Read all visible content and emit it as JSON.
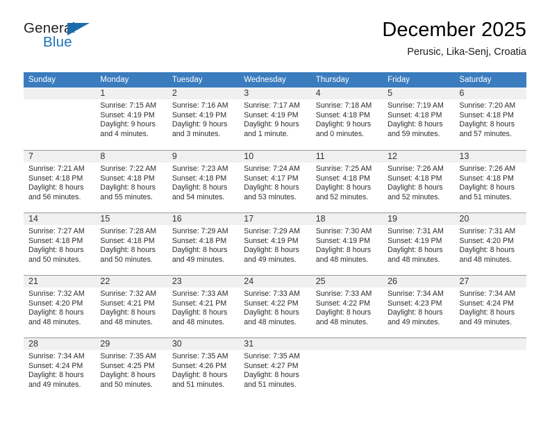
{
  "brand": {
    "name_part1": "General",
    "name_part2": "Blue",
    "accent_color": "#1b72b8",
    "triangle_icon": "triangle-icon"
  },
  "header": {
    "title": "December 2025",
    "location": "Perusic, Lika-Senj, Croatia"
  },
  "calendar": {
    "header_bg": "#3a7cbe",
    "weekday_headers": [
      "Sunday",
      "Monday",
      "Tuesday",
      "Wednesday",
      "Thursday",
      "Friday",
      "Saturday"
    ],
    "weeks": [
      [
        {
          "day": "",
          "sunrise": "",
          "sunset": "",
          "daylight_line1": "",
          "daylight_line2": ""
        },
        {
          "day": "1",
          "sunrise": "Sunrise: 7:15 AM",
          "sunset": "Sunset: 4:19 PM",
          "daylight_line1": "Daylight: 9 hours",
          "daylight_line2": "and 4 minutes."
        },
        {
          "day": "2",
          "sunrise": "Sunrise: 7:16 AM",
          "sunset": "Sunset: 4:19 PM",
          "daylight_line1": "Daylight: 9 hours",
          "daylight_line2": "and 3 minutes."
        },
        {
          "day": "3",
          "sunrise": "Sunrise: 7:17 AM",
          "sunset": "Sunset: 4:19 PM",
          "daylight_line1": "Daylight: 9 hours",
          "daylight_line2": "and 1 minute."
        },
        {
          "day": "4",
          "sunrise": "Sunrise: 7:18 AM",
          "sunset": "Sunset: 4:18 PM",
          "daylight_line1": "Daylight: 9 hours",
          "daylight_line2": "and 0 minutes."
        },
        {
          "day": "5",
          "sunrise": "Sunrise: 7:19 AM",
          "sunset": "Sunset: 4:18 PM",
          "daylight_line1": "Daylight: 8 hours",
          "daylight_line2": "and 59 minutes."
        },
        {
          "day": "6",
          "sunrise": "Sunrise: 7:20 AM",
          "sunset": "Sunset: 4:18 PM",
          "daylight_line1": "Daylight: 8 hours",
          "daylight_line2": "and 57 minutes."
        }
      ],
      [
        {
          "day": "7",
          "sunrise": "Sunrise: 7:21 AM",
          "sunset": "Sunset: 4:18 PM",
          "daylight_line1": "Daylight: 8 hours",
          "daylight_line2": "and 56 minutes."
        },
        {
          "day": "8",
          "sunrise": "Sunrise: 7:22 AM",
          "sunset": "Sunset: 4:18 PM",
          "daylight_line1": "Daylight: 8 hours",
          "daylight_line2": "and 55 minutes."
        },
        {
          "day": "9",
          "sunrise": "Sunrise: 7:23 AM",
          "sunset": "Sunset: 4:18 PM",
          "daylight_line1": "Daylight: 8 hours",
          "daylight_line2": "and 54 minutes."
        },
        {
          "day": "10",
          "sunrise": "Sunrise: 7:24 AM",
          "sunset": "Sunset: 4:17 PM",
          "daylight_line1": "Daylight: 8 hours",
          "daylight_line2": "and 53 minutes."
        },
        {
          "day": "11",
          "sunrise": "Sunrise: 7:25 AM",
          "sunset": "Sunset: 4:18 PM",
          "daylight_line1": "Daylight: 8 hours",
          "daylight_line2": "and 52 minutes."
        },
        {
          "day": "12",
          "sunrise": "Sunrise: 7:26 AM",
          "sunset": "Sunset: 4:18 PM",
          "daylight_line1": "Daylight: 8 hours",
          "daylight_line2": "and 52 minutes."
        },
        {
          "day": "13",
          "sunrise": "Sunrise: 7:26 AM",
          "sunset": "Sunset: 4:18 PM",
          "daylight_line1": "Daylight: 8 hours",
          "daylight_line2": "and 51 minutes."
        }
      ],
      [
        {
          "day": "14",
          "sunrise": "Sunrise: 7:27 AM",
          "sunset": "Sunset: 4:18 PM",
          "daylight_line1": "Daylight: 8 hours",
          "daylight_line2": "and 50 minutes."
        },
        {
          "day": "15",
          "sunrise": "Sunrise: 7:28 AM",
          "sunset": "Sunset: 4:18 PM",
          "daylight_line1": "Daylight: 8 hours",
          "daylight_line2": "and 50 minutes."
        },
        {
          "day": "16",
          "sunrise": "Sunrise: 7:29 AM",
          "sunset": "Sunset: 4:18 PM",
          "daylight_line1": "Daylight: 8 hours",
          "daylight_line2": "and 49 minutes."
        },
        {
          "day": "17",
          "sunrise": "Sunrise: 7:29 AM",
          "sunset": "Sunset: 4:19 PM",
          "daylight_line1": "Daylight: 8 hours",
          "daylight_line2": "and 49 minutes."
        },
        {
          "day": "18",
          "sunrise": "Sunrise: 7:30 AM",
          "sunset": "Sunset: 4:19 PM",
          "daylight_line1": "Daylight: 8 hours",
          "daylight_line2": "and 48 minutes."
        },
        {
          "day": "19",
          "sunrise": "Sunrise: 7:31 AM",
          "sunset": "Sunset: 4:19 PM",
          "daylight_line1": "Daylight: 8 hours",
          "daylight_line2": "and 48 minutes."
        },
        {
          "day": "20",
          "sunrise": "Sunrise: 7:31 AM",
          "sunset": "Sunset: 4:20 PM",
          "daylight_line1": "Daylight: 8 hours",
          "daylight_line2": "and 48 minutes."
        }
      ],
      [
        {
          "day": "21",
          "sunrise": "Sunrise: 7:32 AM",
          "sunset": "Sunset: 4:20 PM",
          "daylight_line1": "Daylight: 8 hours",
          "daylight_line2": "and 48 minutes."
        },
        {
          "day": "22",
          "sunrise": "Sunrise: 7:32 AM",
          "sunset": "Sunset: 4:21 PM",
          "daylight_line1": "Daylight: 8 hours",
          "daylight_line2": "and 48 minutes."
        },
        {
          "day": "23",
          "sunrise": "Sunrise: 7:33 AM",
          "sunset": "Sunset: 4:21 PM",
          "daylight_line1": "Daylight: 8 hours",
          "daylight_line2": "and 48 minutes."
        },
        {
          "day": "24",
          "sunrise": "Sunrise: 7:33 AM",
          "sunset": "Sunset: 4:22 PM",
          "daylight_line1": "Daylight: 8 hours",
          "daylight_line2": "and 48 minutes."
        },
        {
          "day": "25",
          "sunrise": "Sunrise: 7:33 AM",
          "sunset": "Sunset: 4:22 PM",
          "daylight_line1": "Daylight: 8 hours",
          "daylight_line2": "and 48 minutes."
        },
        {
          "day": "26",
          "sunrise": "Sunrise: 7:34 AM",
          "sunset": "Sunset: 4:23 PM",
          "daylight_line1": "Daylight: 8 hours",
          "daylight_line2": "and 49 minutes."
        },
        {
          "day": "27",
          "sunrise": "Sunrise: 7:34 AM",
          "sunset": "Sunset: 4:24 PM",
          "daylight_line1": "Daylight: 8 hours",
          "daylight_line2": "and 49 minutes."
        }
      ],
      [
        {
          "day": "28",
          "sunrise": "Sunrise: 7:34 AM",
          "sunset": "Sunset: 4:24 PM",
          "daylight_line1": "Daylight: 8 hours",
          "daylight_line2": "and 49 minutes."
        },
        {
          "day": "29",
          "sunrise": "Sunrise: 7:35 AM",
          "sunset": "Sunset: 4:25 PM",
          "daylight_line1": "Daylight: 8 hours",
          "daylight_line2": "and 50 minutes."
        },
        {
          "day": "30",
          "sunrise": "Sunrise: 7:35 AM",
          "sunset": "Sunset: 4:26 PM",
          "daylight_line1": "Daylight: 8 hours",
          "daylight_line2": "and 51 minutes."
        },
        {
          "day": "31",
          "sunrise": "Sunrise: 7:35 AM",
          "sunset": "Sunset: 4:27 PM",
          "daylight_line1": "Daylight: 8 hours",
          "daylight_line2": "and 51 minutes."
        },
        {
          "day": "",
          "sunrise": "",
          "sunset": "",
          "daylight_line1": "",
          "daylight_line2": ""
        },
        {
          "day": "",
          "sunrise": "",
          "sunset": "",
          "daylight_line1": "",
          "daylight_line2": ""
        },
        {
          "day": "",
          "sunrise": "",
          "sunset": "",
          "daylight_line1": "",
          "daylight_line2": ""
        }
      ]
    ]
  }
}
